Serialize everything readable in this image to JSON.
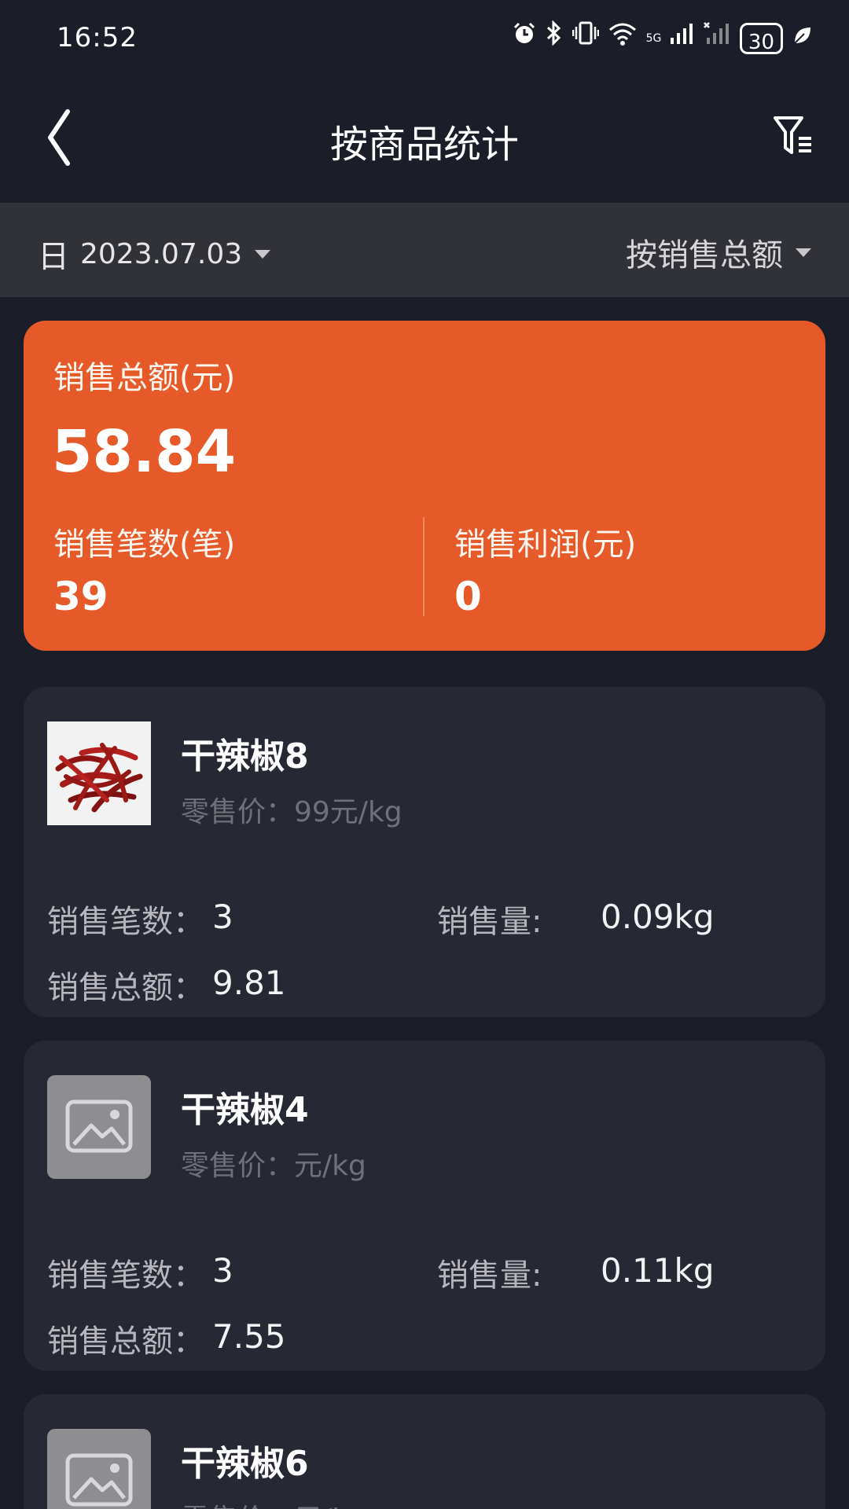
{
  "status_bar": {
    "time": "16:52",
    "icons": [
      "alarm-icon",
      "bluetooth-icon",
      "vibrate-icon",
      "wifi-icon",
      "signal-5g-icon",
      "signal-x-icon",
      "battery-icon",
      "leaf-icon"
    ],
    "network_label": "5G",
    "battery_level": "30"
  },
  "header": {
    "title": "按商品统计",
    "back_icon": "chevron-left-icon",
    "filter_icon": "filter-icon"
  },
  "filter_bar": {
    "period": "日",
    "date": "2023.07.03",
    "sort": "按销售总额"
  },
  "summary": {
    "total_label": "销售总额(元)",
    "total_value": "58.84",
    "count_label": "销售笔数(笔)",
    "count_value": "39",
    "profit_label": "销售利润(元)",
    "profit_value": "0",
    "accent_color": "#e55a28"
  },
  "products": [
    {
      "name": "干辣椒8",
      "price": "零售价：99元/kg",
      "count_label": "销售笔数：",
      "count": "3",
      "qty_label": "销售量:",
      "qty": "0.09kg",
      "total_label": "销售总额：",
      "total": "9.81",
      "image": "chili-photo"
    },
    {
      "name": "干辣椒4",
      "price": "零售价：元/kg",
      "count_label": "销售笔数：",
      "count": "3",
      "qty_label": "销售量:",
      "qty": "0.11kg",
      "total_label": "销售总额：",
      "total": "7.55",
      "image": "image-placeholder-icon"
    },
    {
      "name": "干辣椒6",
      "price": "零售价：元/k",
      "image": "image-placeholder-icon"
    }
  ]
}
